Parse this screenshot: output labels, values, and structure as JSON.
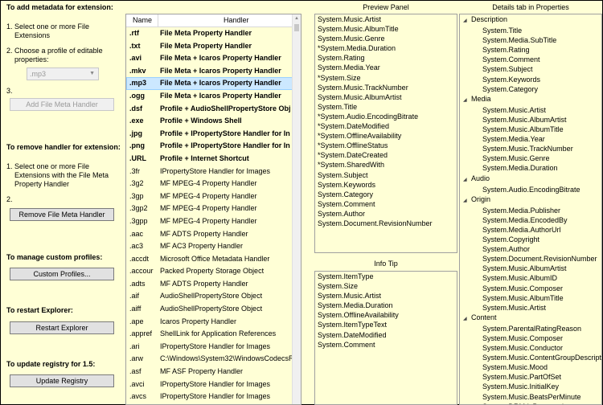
{
  "left": {
    "add_title": "To add metadata for extension:",
    "add_step1_num": "1.",
    "add_step1": "Select one or more File Extensions",
    "add_step2_num": "2.",
    "add_step2": "Choose a profile of editable properties:",
    "profile_select": ".mp3",
    "add_step3_num": "3.",
    "add_button": "Add File Meta Handler",
    "remove_title": "To remove handler for extension:",
    "remove_step1_num": "1.",
    "remove_step1": "Select one or more File Extensions with the File Meta Property Handler",
    "remove_step2_num": "2.",
    "remove_button": "Remove File Meta Handler",
    "profiles_title": "To manage custom profiles:",
    "profiles_button": "Custom Profiles...",
    "restart_title": "To restart Explorer:",
    "restart_button": "Restart Explorer",
    "registry_title": "To update registry for 1.5:",
    "registry_button": "Update Registry"
  },
  "extensions": {
    "col_name": "Name",
    "col_handler": "Handler",
    "rows": [
      {
        "ext": ".rtf",
        "handler": "File Meta Property Handler",
        "bold": true
      },
      {
        "ext": ".txt",
        "handler": "File Meta Property Handler",
        "bold": true
      },
      {
        "ext": ".avi",
        "handler": "File Meta + Icaros Property Handler",
        "bold": true
      },
      {
        "ext": ".mkv",
        "handler": "File Meta + Icaros Property Handler",
        "bold": true
      },
      {
        "ext": ".mp3",
        "handler": "File Meta + Icaros Property Handler",
        "bold": true,
        "selected": true
      },
      {
        "ext": ".ogg",
        "handler": "File Meta + Icaros Property Handler",
        "bold": true
      },
      {
        "ext": ".dsf",
        "handler": "Profile + AudioShellPropertyStore Obj",
        "bold": true
      },
      {
        "ext": ".exe",
        "handler": "Profile + Windows Shell",
        "bold": true
      },
      {
        "ext": ".jpg",
        "handler": "Profile + IPropertyStore Handler for In",
        "bold": true
      },
      {
        "ext": ".png",
        "handler": "Profile + IPropertyStore Handler for In",
        "bold": true
      },
      {
        "ext": ".URL",
        "handler": "Profile + Internet Shortcut",
        "bold": true
      },
      {
        "ext": ".3fr",
        "handler": "IPropertyStore Handler for Images",
        "bold": false
      },
      {
        "ext": ".3g2",
        "handler": "MF MPEG-4 Property Handler",
        "bold": false
      },
      {
        "ext": ".3gp",
        "handler": "MF MPEG-4 Property Handler",
        "bold": false
      },
      {
        "ext": ".3gp2",
        "handler": "MF MPEG-4 Property Handler",
        "bold": false
      },
      {
        "ext": ".3gpp",
        "handler": "MF MPEG-4 Property Handler",
        "bold": false
      },
      {
        "ext": ".aac",
        "handler": "MF ADTS Property Handler",
        "bold": false
      },
      {
        "ext": ".ac3",
        "handler": "MF AC3 Property Handler",
        "bold": false
      },
      {
        "ext": ".accdt",
        "handler": "Microsoft Office Metadata Handler",
        "bold": false
      },
      {
        "ext": ".accour",
        "handler": "Packed Property Storage Object",
        "bold": false
      },
      {
        "ext": ".adts",
        "handler": "MF ADTS Property Handler",
        "bold": false
      },
      {
        "ext": ".aif",
        "handler": "AudioShellPropertyStore Object",
        "bold": false
      },
      {
        "ext": ".aiff",
        "handler": "AudioShellPropertyStore Object",
        "bold": false
      },
      {
        "ext": ".ape",
        "handler": "Icaros Property Handler",
        "bold": false
      },
      {
        "ext": ".appref",
        "handler": "ShellLink for Application References",
        "bold": false
      },
      {
        "ext": ".ari",
        "handler": "IPropertyStore Handler for Images",
        "bold": false
      },
      {
        "ext": ".arw",
        "handler": "C:\\Windows\\System32\\WindowsCodecsR",
        "bold": false
      },
      {
        "ext": ".asf",
        "handler": "MF ASF Property Handler",
        "bold": false
      },
      {
        "ext": ".avci",
        "handler": "IPropertyStore Handler for Images",
        "bold": false
      },
      {
        "ext": ".avcs",
        "handler": "IPropertyStore Handler for Images",
        "bold": false
      }
    ]
  },
  "preview": {
    "title": "Preview Panel",
    "items": [
      "System.Music.Artist",
      "System.Music.AlbumTitle",
      "System.Music.Genre",
      "*System.Media.Duration",
      "System.Rating",
      "System.Media.Year",
      "*System.Size",
      "System.Music.TrackNumber",
      "System.Music.AlbumArtist",
      "System.Title",
      "*System.Audio.EncodingBitrate",
      "*System.DateModified",
      "*System.OfflineAvailability",
      "*System.OfflineStatus",
      "*System.DateCreated",
      "*System.SharedWith",
      "System.Subject",
      "System.Keywords",
      "System.Category",
      "System.Comment",
      "System.Author",
      "System.Document.RevisionNumber"
    ]
  },
  "infotip": {
    "title": "Info Tip",
    "items": [
      "System.ItemType",
      "System.Size",
      "System.Music.Artist",
      "System.Media.Duration",
      "System.OfflineAvailability",
      "System.ItemTypeText",
      "System.DateModified",
      "System.Comment"
    ]
  },
  "details": {
    "title": "Details tab in Properties",
    "groups": [
      {
        "name": "Description",
        "items": [
          "System.Title",
          "System.Media.SubTitle",
          "System.Rating",
          "System.Comment",
          "System.Subject",
          "System.Keywords",
          "System.Category"
        ]
      },
      {
        "name": "Media",
        "items": [
          "System.Music.Artist",
          "System.Music.AlbumArtist",
          "System.Music.AlbumTitle",
          "System.Media.Year",
          "System.Music.TrackNumber",
          "System.Music.Genre",
          "System.Media.Duration"
        ]
      },
      {
        "name": "Audio",
        "items": [
          "System.Audio.EncodingBitrate"
        ]
      },
      {
        "name": "Origin",
        "items": [
          "System.Media.Publisher",
          "System.Media.EncodedBy",
          "System.Media.AuthorUrl",
          "System.Copyright",
          "System.Author",
          "System.Document.RevisionNumber",
          "System.Music.AlbumArtist",
          "System.Music.AlbumID",
          "System.Music.Composer",
          "System.Music.AlbumTitle",
          "System.Music.Artist"
        ]
      },
      {
        "name": "Content",
        "items": [
          "System.ParentalRatingReason",
          "System.Music.Composer",
          "System.Music.Conductor",
          "System.Music.ContentGroupDescription",
          "System.Music.Mood",
          "System.Music.PartOfSet",
          "System.Music.InitialKey",
          "System.Music.BeatsPerMinute",
          "System.DRM.IsProtected"
        ]
      }
    ]
  }
}
